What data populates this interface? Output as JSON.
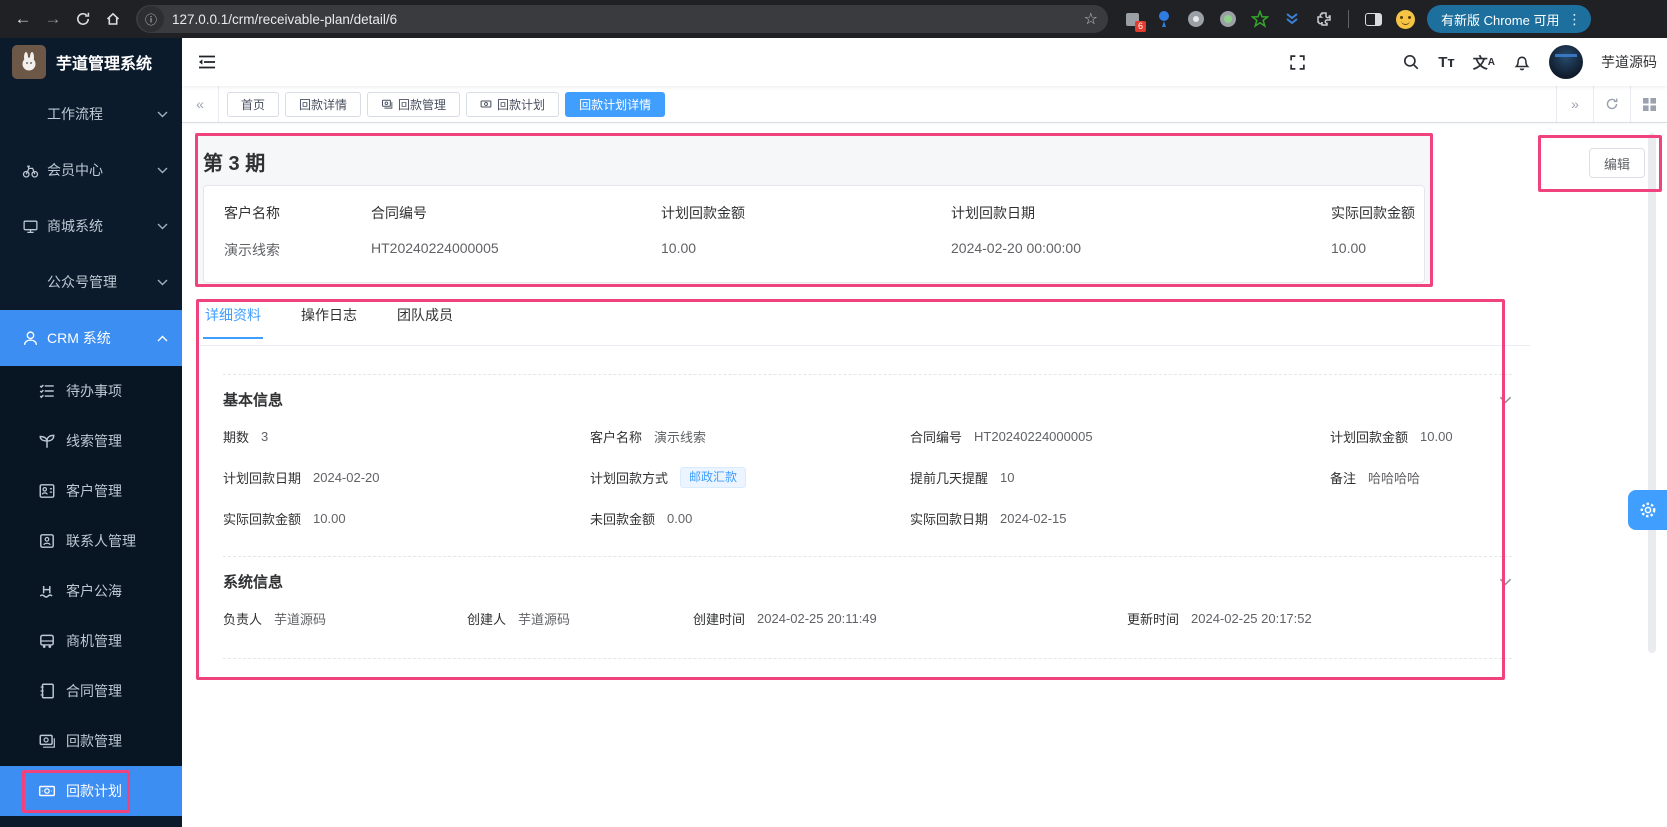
{
  "browser": {
    "url": "127.0.0.1/crm/receivable-plan/detail/6",
    "update_pill": "有新版 Chrome 可用",
    "extension_badge": "6"
  },
  "app": {
    "logo_title": "芋道管理系统",
    "username": "芋道源码"
  },
  "sidebar": {
    "items": [
      {
        "label": "工作流程"
      },
      {
        "label": "会员中心"
      },
      {
        "label": "商城系统"
      },
      {
        "label": "公众号管理"
      },
      {
        "label": "CRM 系统"
      }
    ],
    "submenu": [
      {
        "label": "待办事项"
      },
      {
        "label": "线索管理"
      },
      {
        "label": "客户管理"
      },
      {
        "label": "联系人管理"
      },
      {
        "label": "客户公海"
      },
      {
        "label": "商机管理"
      },
      {
        "label": "合同管理"
      },
      {
        "label": "回款管理"
      },
      {
        "label": "回款计划"
      }
    ]
  },
  "tabbar": {
    "tabs": [
      {
        "label": "首页"
      },
      {
        "label": "回款详情"
      },
      {
        "label": "回款管理"
      },
      {
        "label": "回款计划"
      },
      {
        "label": "回款计划详情"
      }
    ]
  },
  "page": {
    "title": "第 3 期",
    "edit_button": "编辑"
  },
  "summary": {
    "fields": [
      {
        "label": "客户名称",
        "value": "演示线索"
      },
      {
        "label": "合同编号",
        "value": "HT20240224000005"
      },
      {
        "label": "计划回款金额",
        "value": "10.00"
      },
      {
        "label": "计划回款日期",
        "value": "2024-02-20 00:00:00"
      },
      {
        "label": "实际回款金额",
        "value": "10.00"
      }
    ]
  },
  "detail": {
    "tabs": [
      {
        "label": "详细资料"
      },
      {
        "label": "操作日志"
      },
      {
        "label": "团队成员"
      }
    ],
    "basic": {
      "title": "基本信息",
      "fields": [
        {
          "label": "期数",
          "value": "3"
        },
        {
          "label": "客户名称",
          "value": "演示线索"
        },
        {
          "label": "合同编号",
          "value": "HT20240224000005"
        },
        {
          "label": "计划回款金额",
          "value": "10.00"
        },
        {
          "label": "计划回款日期",
          "value": "2024-02-20"
        },
        {
          "label": "计划回款方式",
          "value": "邮政汇款"
        },
        {
          "label": "提前几天提醒",
          "value": "10"
        },
        {
          "label": "备注",
          "value": "哈哈哈哈"
        },
        {
          "label": "实际回款金额",
          "value": "10.00"
        },
        {
          "label": "未回款金额",
          "value": "0.00"
        },
        {
          "label": "实际回款日期",
          "value": "2024-02-15"
        }
      ]
    },
    "system": {
      "title": "系统信息",
      "fields": [
        {
          "label": "负责人",
          "value": "芋道源码"
        },
        {
          "label": "创建人",
          "value": "芋道源码"
        },
        {
          "label": "创建时间",
          "value": "2024-02-25 20:11:49"
        },
        {
          "label": "更新时间",
          "value": "2024-02-25 20:17:52"
        }
      ]
    }
  },
  "colors": {
    "accent": "#409eff",
    "annotation_pink": "#f0437d",
    "sidebar_bg": "#0b1b2c",
    "badge_bg": "#ecf5ff"
  }
}
